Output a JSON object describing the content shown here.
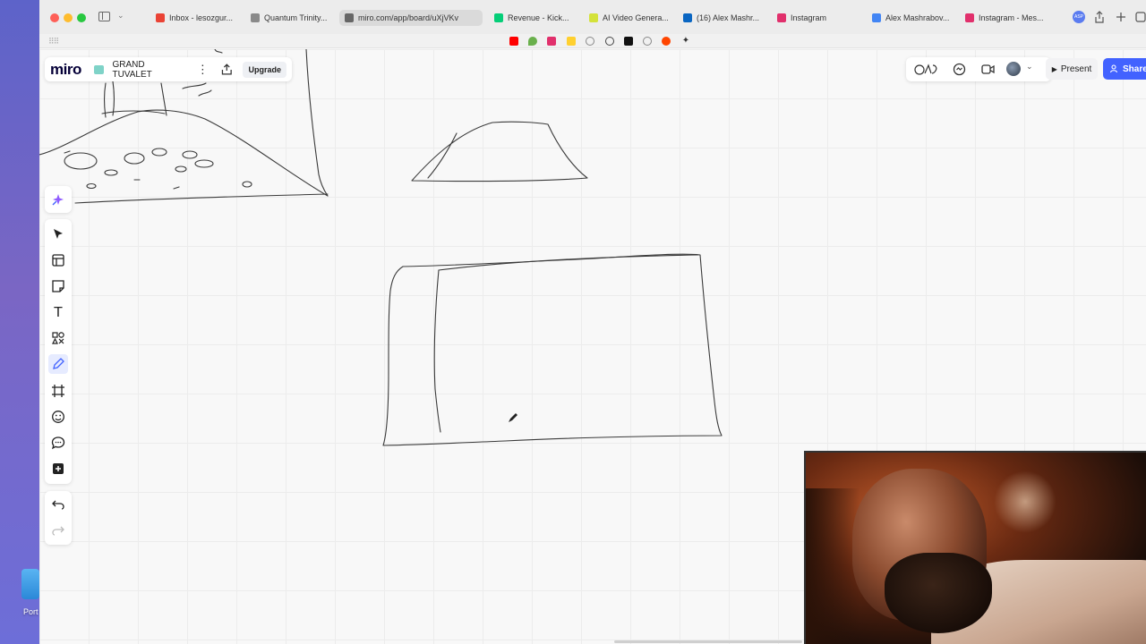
{
  "desktop": {
    "folder_label": "Port"
  },
  "browser": {
    "tabs": [
      {
        "title": "Inbox - lesozgur...",
        "fav_color": "#ea4335"
      },
      {
        "title": "Quantum Trinity...",
        "fav_color": "#8a8a8a"
      },
      {
        "title": "miro.com/app/board/uXjVKv",
        "fav_color": "#666666",
        "active": true
      },
      {
        "title": "Revenue - Kick...",
        "fav_color": "#05ce78"
      },
      {
        "title": "AI Video Genera...",
        "fav_color": "#d4e23a"
      },
      {
        "title": "(16) Alex Mashr...",
        "fav_color": "#0a66c2"
      },
      {
        "title": "Instagram",
        "fav_color": "#e1306c"
      },
      {
        "title": "Alex Mashrabov...",
        "fav_color": "#4285f4"
      },
      {
        "title": "Instagram - Mes...",
        "fav_color": "#e1306c"
      }
    ],
    "profile_badge": "ASP"
  },
  "bookmarks": [
    {
      "icon": "youtube-icon",
      "color": "#ff0000"
    },
    {
      "icon": "drop-icon",
      "color": "#6ab04c"
    },
    {
      "icon": "instagram-icon",
      "color": "#e1306c"
    },
    {
      "icon": "miro-icon",
      "color": "#ffd02f"
    },
    {
      "icon": "globe-icon",
      "color": "#888888"
    },
    {
      "icon": "openai-icon",
      "color": "#444444"
    },
    {
      "icon": "notion-icon",
      "color": "#111111"
    },
    {
      "icon": "reddit-icon",
      "color": "#ff4500"
    },
    {
      "icon": "sparkle-icon",
      "color": "#333333"
    }
  ],
  "board": {
    "logo": "miro",
    "name": "GRAND TUVALET",
    "upgrade_label": "Upgrade"
  },
  "topright": {
    "present_label": "Present",
    "share_label": "Share",
    "accent_color": "#4262ff"
  },
  "toolbar": {
    "tools": [
      {
        "icon": "select-arrow-icon",
        "label": "Select"
      },
      {
        "icon": "templates-icon",
        "label": "Templates"
      },
      {
        "icon": "sticky-note-icon",
        "label": "Sticky note"
      },
      {
        "icon": "text-icon",
        "label": "Text"
      },
      {
        "icon": "shapes-icon",
        "label": "Shapes"
      },
      {
        "icon": "pen-icon",
        "label": "Pen",
        "active": true
      },
      {
        "icon": "frame-icon",
        "label": "Frame"
      },
      {
        "icon": "stickers-icon",
        "label": "Stickers"
      },
      {
        "icon": "comment-icon",
        "label": "Comment"
      },
      {
        "icon": "plus-icon",
        "label": "More apps"
      }
    ],
    "text_tool_glyph": "T"
  }
}
